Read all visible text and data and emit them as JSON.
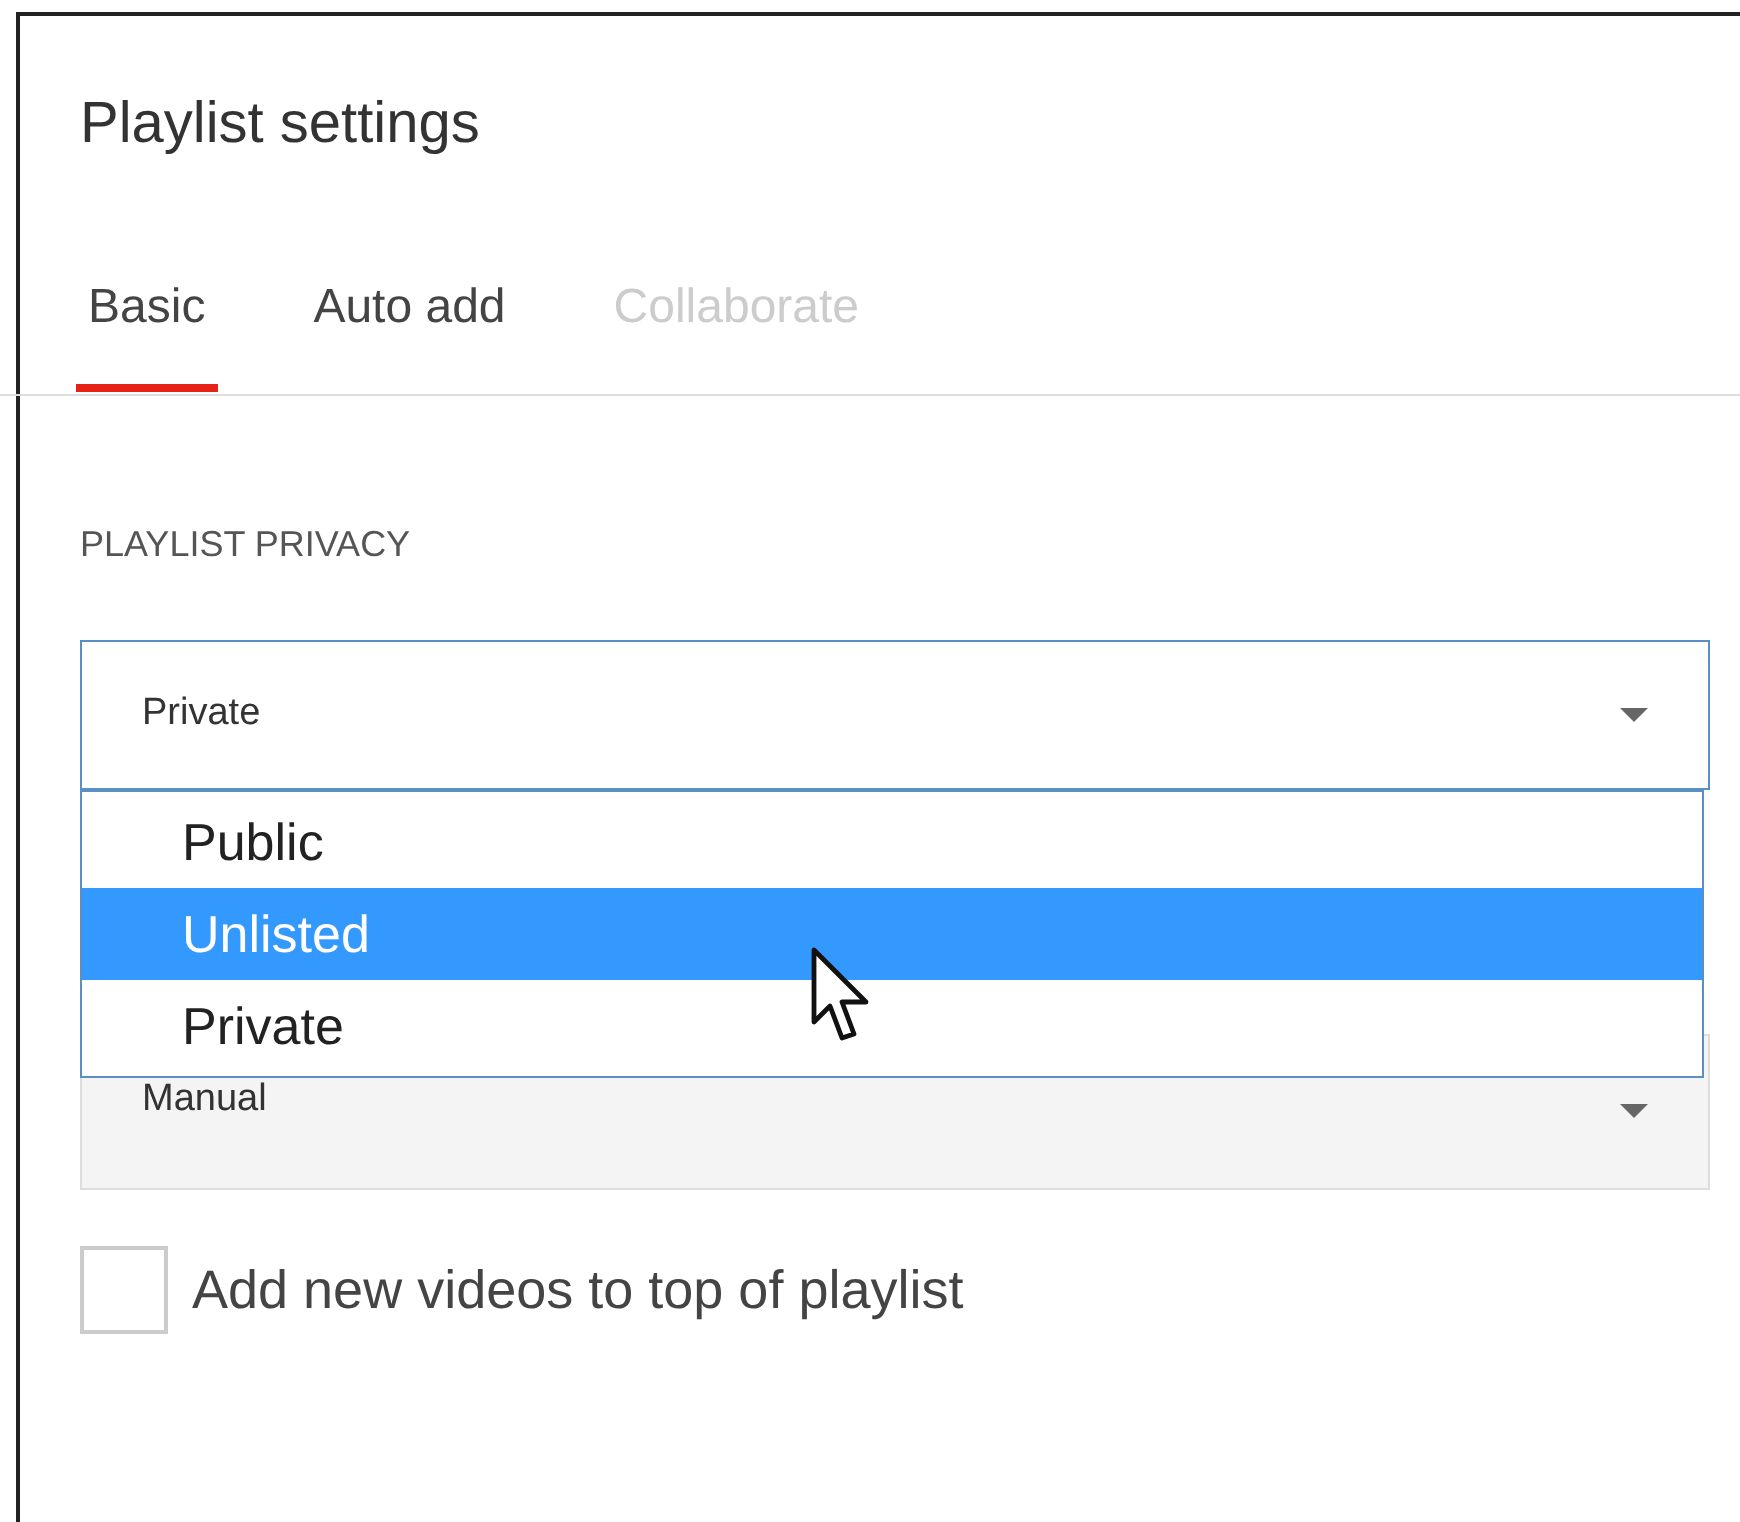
{
  "title": "Playlist settings",
  "tabs": [
    {
      "label": "Basic",
      "selected": true,
      "disabled": false
    },
    {
      "label": "Auto add",
      "selected": false,
      "disabled": false
    },
    {
      "label": "Collaborate",
      "selected": false,
      "disabled": true
    }
  ],
  "privacy": {
    "label": "PLAYLIST PRIVACY",
    "value": "Private",
    "open": true,
    "options": [
      {
        "label": "Public",
        "highlighted": false
      },
      {
        "label": "Unlisted",
        "highlighted": true
      },
      {
        "label": "Private",
        "highlighted": false
      }
    ]
  },
  "ordering": {
    "value": "Manual"
  },
  "top_checkbox": {
    "label": "Add new videos to top of playlist",
    "checked": false
  }
}
